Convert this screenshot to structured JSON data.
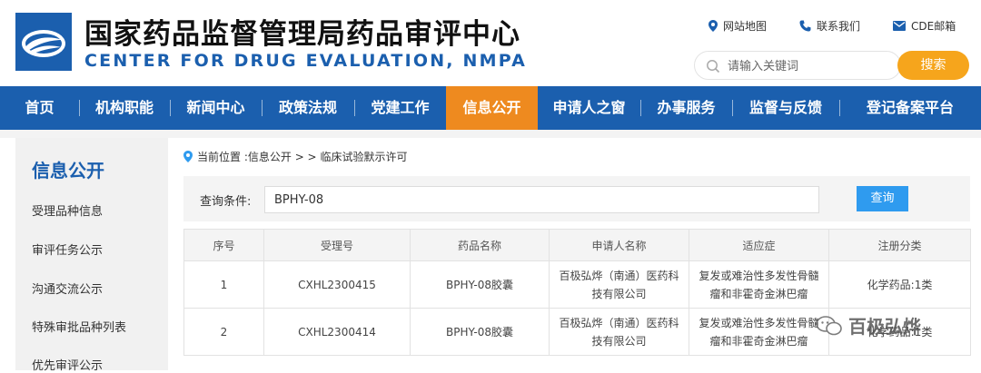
{
  "header": {
    "title_cn": "国家药品监督管理局药品审评中心",
    "title_en": "CENTER FOR DRUG EVALUATION, NMPA",
    "links": [
      {
        "label": "网站地图",
        "icon": "location-pin-icon"
      },
      {
        "label": "联系我们",
        "icon": "phone-icon"
      },
      {
        "label": "CDE邮箱",
        "icon": "mail-icon"
      }
    ],
    "search_placeholder": "请输入关键词",
    "search_button": "搜索"
  },
  "nav": {
    "items": [
      "首页",
      "机构职能",
      "新闻中心",
      "政策法规",
      "党建工作",
      "信息公开",
      "申请人之窗",
      "办事服务",
      "监督与反馈",
      "登记备案平台"
    ],
    "active": "信息公开"
  },
  "sidebar": {
    "title": "信息公开",
    "items": [
      "受理品种信息",
      "审评任务公示",
      "沟通交流公示",
      "特殊审批品种列表",
      "优先审评公示"
    ]
  },
  "breadcrumb": {
    "prefix": "当前位置 : ",
    "path1": "信息公开",
    "sep": " > > ",
    "path2": "临床试验默示许可"
  },
  "query": {
    "label": "查询条件:",
    "value": "BPHY-08",
    "button": "查询"
  },
  "table": {
    "headers": [
      "序号",
      "受理号",
      "药品名称",
      "申请人名称",
      "适应症",
      "注册分类"
    ],
    "rows": [
      {
        "no": "1",
        "acceptance": "CXHL2300415",
        "drug": "BPHY-08胶囊",
        "applicant": "百极弘烨（南通）医药科技有限公司",
        "indication": "复发或难治性多发性骨髓瘤和非霍奇金淋巴瘤",
        "category": "化学药品:1类"
      },
      {
        "no": "2",
        "acceptance": "CXHL2300414",
        "drug": "BPHY-08胶囊",
        "applicant": "百极弘烨（南通）医药科技有限公司",
        "indication": "复发或难治性多发性骨髓瘤和非霍奇金淋巴瘤",
        "category": "化学药品:1类"
      }
    ]
  },
  "watermark": "百极弘烨",
  "colors": {
    "brand_blue": "#1b5fae",
    "nav_active": "#ee8a1f",
    "search_btn": "#f6a51c",
    "query_btn": "#2f9bef"
  }
}
